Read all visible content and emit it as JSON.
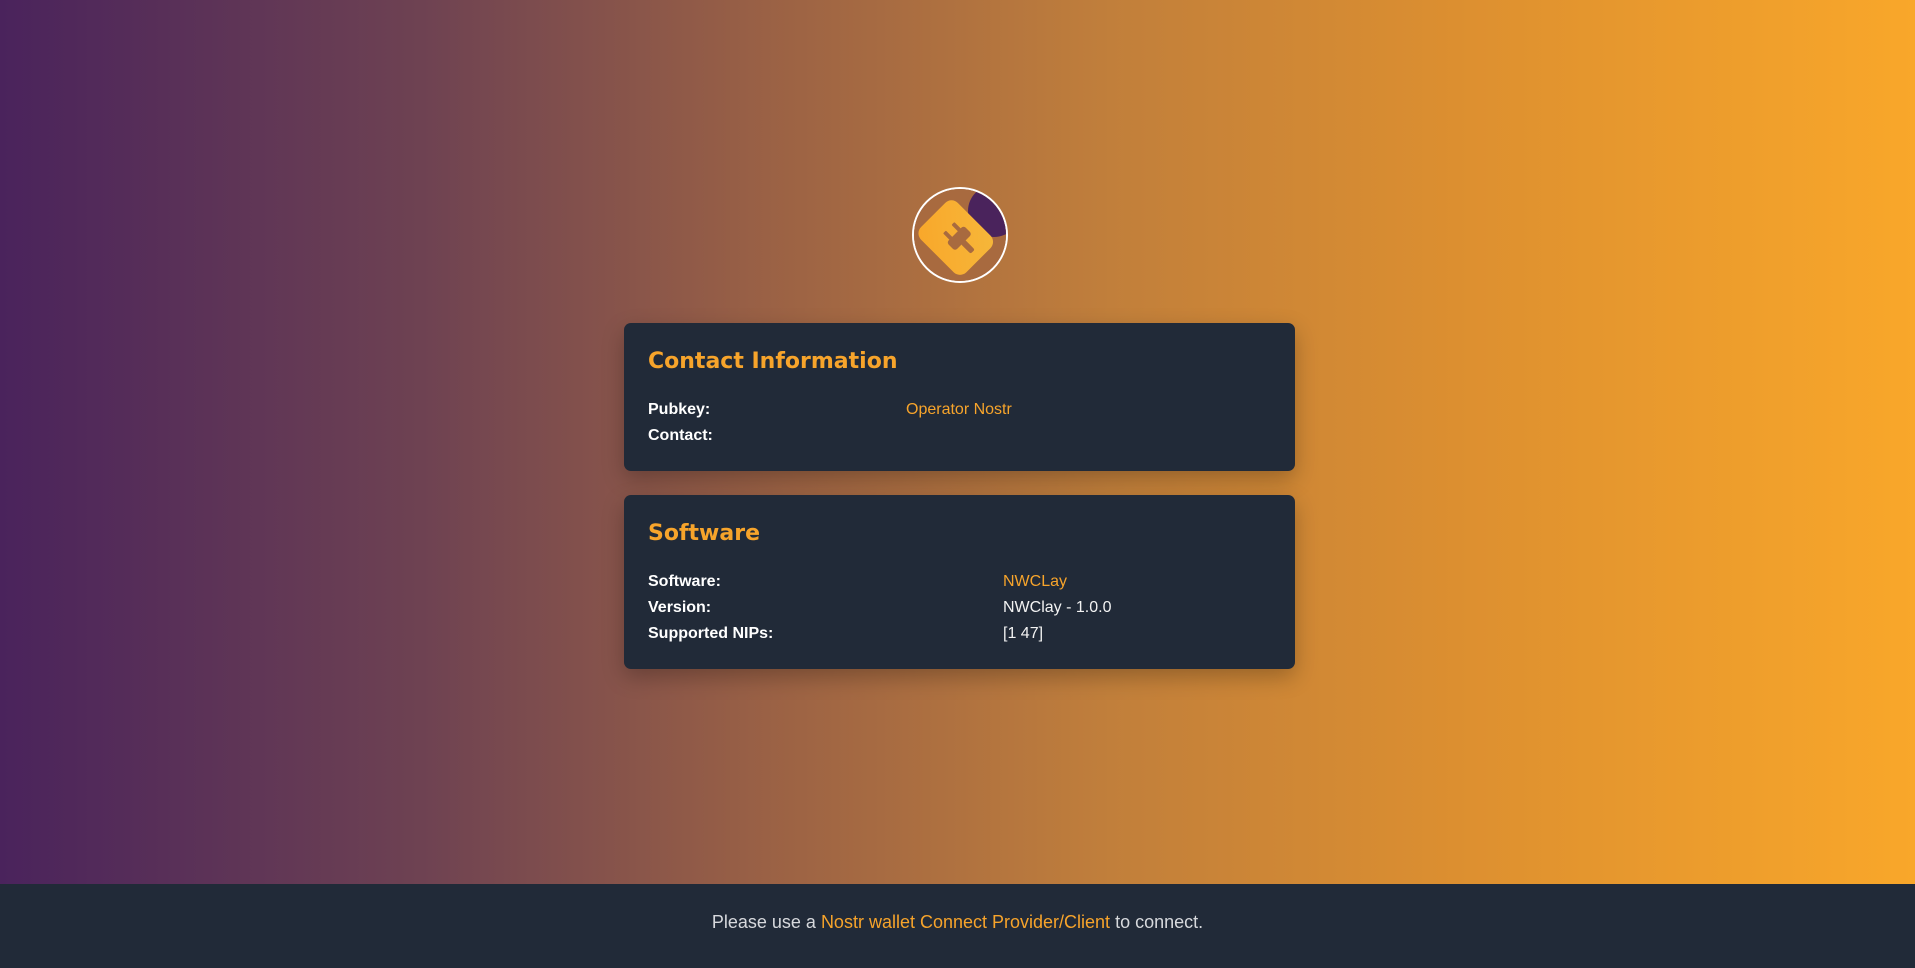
{
  "brand": {
    "logo_icon": "plug-wallet-logo-icon",
    "colors": {
      "accent": "#f7a42b",
      "card_bg": "#212a38",
      "gradient_start": "#4a235c",
      "gradient_end": "#f9a72a"
    }
  },
  "contact": {
    "title": "Contact Information",
    "pubkey_label": "Pubkey:",
    "pubkey_value": "Operator Nostr",
    "contact_label": "Contact:",
    "contact_value": ""
  },
  "software": {
    "title": "Software",
    "software_label": "Software:",
    "software_value": "NWCLay",
    "version_label": "Version:",
    "version_value": "NWClay - 1.0.0",
    "nips_label": "Supported NIPs:",
    "nips_value": "[1 47]"
  },
  "footer": {
    "prefix": "Please use a ",
    "link_text": "Nostr wallet Connect Provider/Client",
    "suffix": " to connect."
  }
}
